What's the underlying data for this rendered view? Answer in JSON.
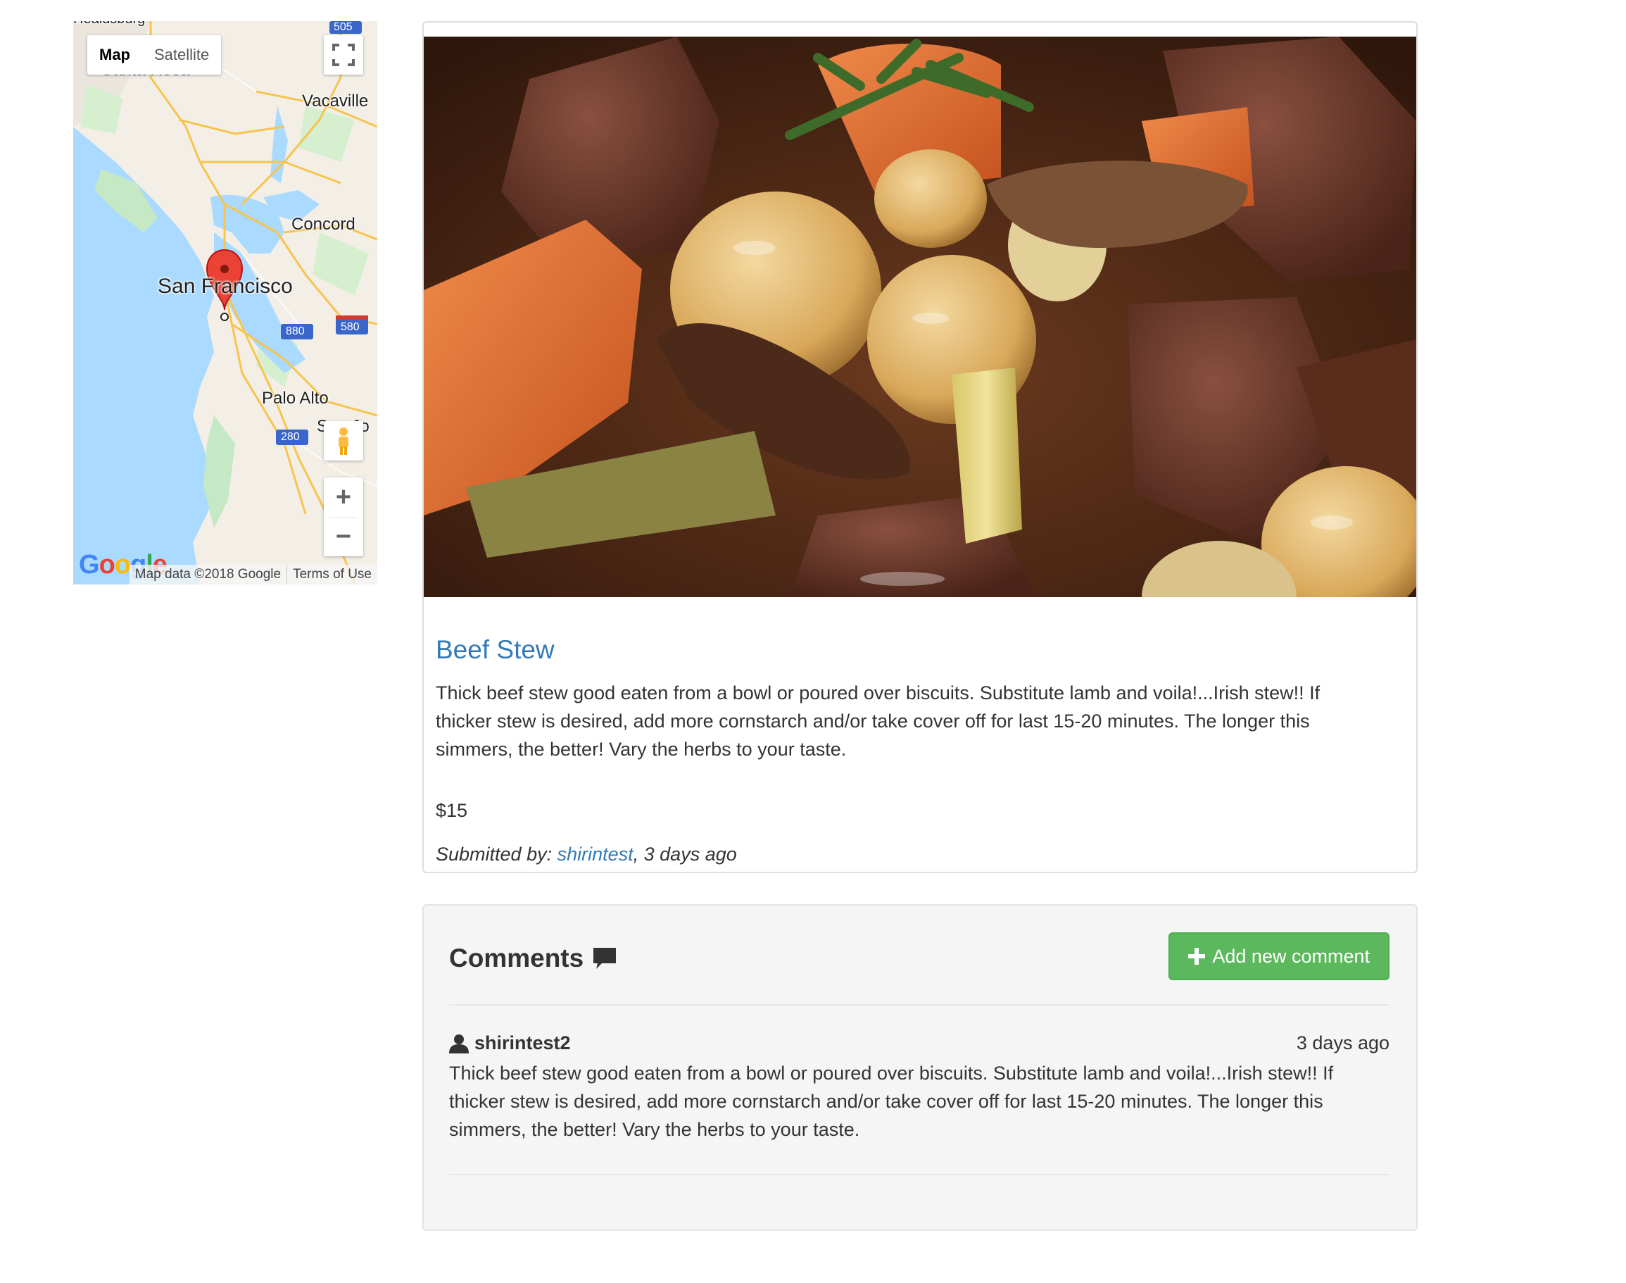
{
  "map": {
    "type_map": "Map",
    "type_satellite": "Satellite",
    "labels": {
      "healdsburg": "Healdsburg",
      "santa_rosa": "Santa Rosa",
      "vacaville": "Vacaville",
      "concord": "Concord",
      "san_francisco": "San Francisco",
      "palo_alto": "Palo Alto",
      "san_jose": "San Jo"
    },
    "shields": {
      "i505": "505",
      "i880": "880",
      "i580": "580",
      "i280": "280"
    },
    "zoom_in": "+",
    "zoom_out": "−",
    "google_logo": "Google",
    "attribution": "Map data ©2018 Google",
    "terms": "Terms of Use"
  },
  "post": {
    "title": "Beef Stew",
    "description": "Thick beef stew good eaten from a bowl or poured over biscuits. Substitute lamb and voila!...Irish stew!! If thicker stew is desired, add more cornstarch and/or take cover off for last 15-20 minutes. The longer this simmers, the better! Vary the herbs to your taste.",
    "price": "$15",
    "submitted_prefix": "Submitted by: ",
    "author": "shirintest",
    "submitted_suffix": ", 3 days ago"
  },
  "comments": {
    "title": "Comments",
    "add_button": "Add new comment",
    "items": [
      {
        "author": "shirintest2",
        "time": "3 days ago",
        "text": "Thick beef stew good eaten from a bowl or poured over biscuits. Substitute lamb and voila!...Irish stew!! If thicker stew is desired, add more cornstarch and/or take cover off for last 15-20 minutes. The longer this simmers, the better! Vary the herbs to your taste."
      }
    ]
  },
  "colors": {
    "link": "#337ab7",
    "button_success": "#5cb85c",
    "map_water": "#aadaff",
    "map_pin": "#ea4335"
  }
}
